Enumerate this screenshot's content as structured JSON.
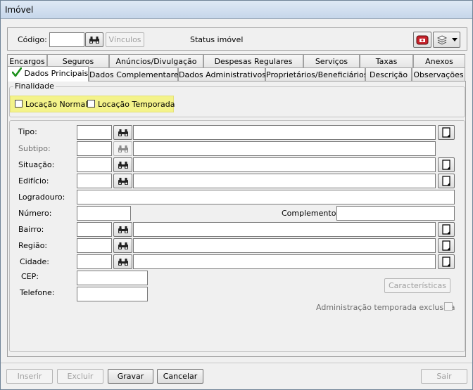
{
  "window": {
    "title": "Imóvel"
  },
  "header": {
    "codigo_label": "Código:",
    "codigo_value": "",
    "vinculos_label": "Vínculos",
    "status_label": "Status imóvel"
  },
  "tabs_row1": [
    "Encargos",
    "Seguros",
    "Anúncios/Divulgação",
    "Despesas Regulares",
    "Serviços",
    "Taxas",
    "Anexos"
  ],
  "tabs_row2": [
    "Dados Principais",
    "Dados Complementares",
    "Dados Administrativos",
    "Proprietários/Beneficiários",
    "Descrição",
    "Observações"
  ],
  "finalidade": {
    "title": "Finalidade",
    "opt1": "Locação Normal",
    "opt2": "Locação Temporada"
  },
  "fields": {
    "tipo": "Tipo:",
    "subtipo": "Subtipo:",
    "situacao": "Situação:",
    "edificio": "Edifício:",
    "logradouro": "Logradouro:",
    "numero": "Número:",
    "complemento": "Complemento:",
    "bairro": "Bairro:",
    "regiao": "Região:",
    "cidade": "Cidade:",
    "cep": "CEP:",
    "telefone": "Telefone:"
  },
  "caracteristicas_label": "Características",
  "adm_temporada_label": "Administração temporada exclusiva",
  "footer": {
    "inserir": "Inserir",
    "excluir": "Excluir",
    "gravar": "Gravar",
    "cancelar": "Cancelar",
    "sair": "Sair"
  },
  "colors": {
    "highlight": "#f4f38a",
    "check": "#1a8f1a"
  }
}
